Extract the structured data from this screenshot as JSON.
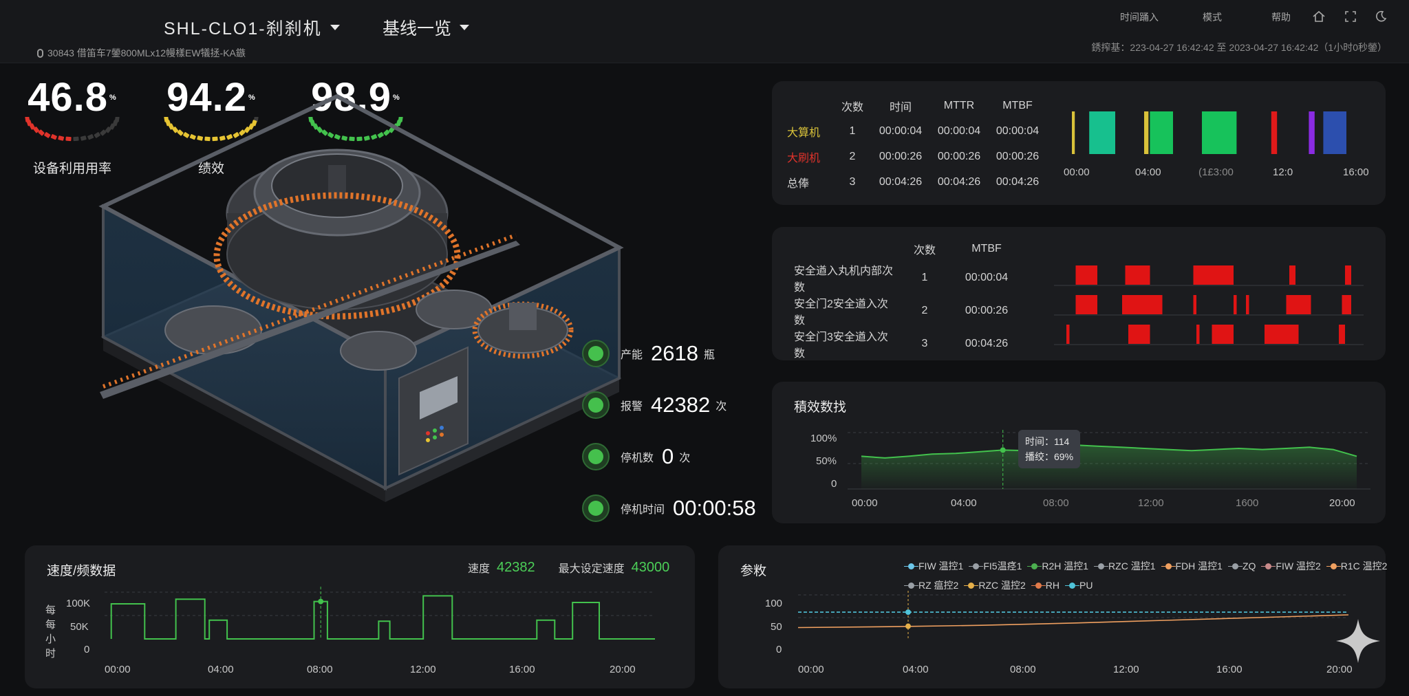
{
  "header": {
    "title": "SHL-CLO1-刹刹机",
    "baseline": "基线一览",
    "subinfo": "30843 借笛车7鎣800MLx12幔樣EW犠拯-KA鏃",
    "menu": [
      "时间踊入",
      "模式",
      "帮助"
    ],
    "time_range": "銹搾基：223-04-27 16:42:42 至 2023-04-27 16:42:42（1小时0秒鎣）"
  },
  "kpis": [
    {
      "value": "46.8",
      "unit": "%",
      "label": "设备利用用率",
      "color": "#e0332b",
      "fraction": 0.468
    },
    {
      "value": "94.2",
      "unit": "%",
      "label": "绩效",
      "color": "#e6c433",
      "fraction": 0.942
    },
    {
      "value": "98.9",
      "unit": "%",
      "label": "质量",
      "color": "#43c24d",
      "fraction": 0.989
    }
  ],
  "stats": [
    {
      "label": "产能",
      "value": "2618",
      "unit": "瓶"
    },
    {
      "label": "报警",
      "value": "42382",
      "unit": "次"
    },
    {
      "label": "停机数",
      "value": "0",
      "unit": "次"
    },
    {
      "label": "停机时间",
      "value": "00:00:58",
      "unit": ""
    }
  ],
  "downtime_card": {
    "headers": [
      "",
      "次数",
      "时间",
      "MTTR",
      "MTBF"
    ],
    "rows": [
      {
        "name": "大算机",
        "color": "#d9c23a",
        "count": "1",
        "time": "00:00:04",
        "mttr": "00:00:04",
        "mtbf": "00:00:04"
      },
      {
        "name": "大刷机",
        "color": "#e0332b",
        "count": "2",
        "time": "00:00:26",
        "mttr": "00:00:26",
        "mtbf": "00:00:26"
      },
      {
        "name": "总俸",
        "color": "#d4d4d4",
        "count": "3",
        "time": "00:04:26",
        "mttr": "00:04:26",
        "mtbf": "00:04:26"
      }
    ],
    "timeline_ticks": [
      "00:00",
      "04:00",
      "(1£3:00",
      "12:0",
      "16:00"
    ],
    "timeline_blocks": [
      {
        "start": 0.0,
        "end": 0.01,
        "color": "#d9c23a"
      },
      {
        "start": 0.06,
        "end": 0.15,
        "color": "#17c08e"
      },
      {
        "start": 0.25,
        "end": 0.265,
        "color": "#d9c23a"
      },
      {
        "start": 0.27,
        "end": 0.35,
        "color": "#17c25b"
      },
      {
        "start": 0.45,
        "end": 0.57,
        "color": "#17c25b"
      },
      {
        "start": 0.69,
        "end": 0.71,
        "color": "#e01a1a"
      },
      {
        "start": 0.82,
        "end": 0.84,
        "color": "#8a2be2"
      },
      {
        "start": 0.87,
        "end": 0.95,
        "color": "#2c4fae"
      }
    ]
  },
  "safety_card": {
    "headers": [
      "",
      "次数",
      "MTBF"
    ],
    "rows": [
      {
        "name": "安全遒入丸机内部次数",
        "count": "1",
        "mtbf": "00:00:04",
        "blocks": [
          [
            0.07,
            0.14
          ],
          [
            0.23,
            0.31
          ],
          [
            0.45,
            0.58
          ],
          [
            0.76,
            0.78
          ],
          [
            0.94,
            0.96
          ]
        ]
      },
      {
        "name": "安全门2安全遒入次数",
        "count": "2",
        "mtbf": "00:00:26",
        "blocks": [
          [
            0.07,
            0.14
          ],
          [
            0.22,
            0.35
          ],
          [
            0.45,
            0.46
          ],
          [
            0.58,
            0.59
          ],
          [
            0.62,
            0.63
          ],
          [
            0.75,
            0.83
          ],
          [
            0.93,
            0.96
          ]
        ]
      },
      {
        "name": "安全门3安全遒入次数",
        "count": "3",
        "mtbf": "00:04:26",
        "blocks": [
          [
            0.04,
            0.05
          ],
          [
            0.24,
            0.31
          ],
          [
            0.46,
            0.47
          ],
          [
            0.51,
            0.58
          ],
          [
            0.68,
            0.79
          ],
          [
            0.92,
            0.94
          ]
        ]
      }
    ]
  },
  "performance_card": {
    "title": "積效数找",
    "y_ticks": [
      "100%",
      "50%",
      "0"
    ],
    "x_ticks": [
      "00:00",
      "04:00",
      "08:00",
      "12:00",
      "1600",
      "20:00"
    ],
    "tooltip": {
      "time": "时间：114",
      "value": "播绞：69%"
    }
  },
  "speed_card": {
    "title": "速度/频数据",
    "speed_label": "速度",
    "speed_value": "42382",
    "max_label": "最大设定速度",
    "max_value": "43000",
    "y_ticks": [
      "100K",
      "50K",
      "0"
    ],
    "y_label": "每 每小时",
    "x_ticks": [
      "00:00",
      "04:00",
      "08:00",
      "12:00",
      "16:00",
      "20:00"
    ]
  },
  "params_card": {
    "title": "参敉",
    "legend": [
      {
        "name": "FIW 温控1",
        "color": "#6cc7ea"
      },
      {
        "name": "FI5温痉1",
        "color": "#9aa0a6"
      },
      {
        "name": "R2H 温控1",
        "color": "#4caf50"
      },
      {
        "name": "RZC 温控1",
        "color": "#9aa0a6"
      },
      {
        "name": "FDH 温控1",
        "color": "#f0a060"
      },
      {
        "name": "ZQ",
        "color": "#9aa0a6"
      },
      {
        "name": "FIW 温控2",
        "color": "#c98a8a"
      },
      {
        "name": "R1C 温控2",
        "color": "#f0a060"
      },
      {
        "name": "RZ 瘟控2",
        "color": "#9aa0a6"
      },
      {
        "name": "RZC 温控2",
        "color": "#e6b04a"
      },
      {
        "name": "RH",
        "color": "#e07a4a"
      },
      {
        "name": "PU",
        "color": "#4fc3d9"
      }
    ],
    "y_ticks": [
      "100",
      "50",
      "0"
    ],
    "x_ticks": [
      "00:00",
      "04:00",
      "08:00",
      "12:00",
      "16:00",
      "20:00"
    ]
  },
  "chart_data": [
    {
      "type": "area",
      "title": "積效数找",
      "x": [
        0,
        1,
        2,
        3,
        4,
        5,
        6,
        7,
        8,
        9,
        10,
        11,
        12,
        13,
        14,
        15,
        16,
        17,
        18,
        19,
        20,
        21
      ],
      "series": [
        {
          "values": [
            58,
            55,
            58,
            62,
            63,
            66,
            69,
            68,
            74,
            78,
            76,
            74,
            72,
            70,
            68,
            70,
            72,
            70,
            72,
            74,
            70,
            58
          ]
        }
      ],
      "ylim": [
        0,
        100
      ]
    },
    {
      "type": "line",
      "title": "速度/频数据",
      "x": [
        "00:00",
        "04:00",
        "08:00",
        "12:00",
        "16:00",
        "20:00"
      ],
      "series": [
        {
          "values": [
            [
              0.3,
              0
            ],
            [
              0.3,
              75
            ],
            [
              1.8,
              75
            ],
            [
              1.8,
              0
            ],
            [
              3.2,
              0
            ],
            [
              3.2,
              85
            ],
            [
              4.5,
              85
            ],
            [
              4.5,
              0
            ],
            [
              4.7,
              0
            ],
            [
              4.7,
              40
            ],
            [
              5.5,
              40
            ],
            [
              5.5,
              0
            ],
            [
              9.4,
              0
            ],
            [
              9.4,
              80
            ],
            [
              10.0,
              80
            ],
            [
              10.0,
              0
            ],
            [
              12.3,
              0
            ],
            [
              12.3,
              38
            ],
            [
              12.8,
              38
            ],
            [
              12.8,
              0
            ],
            [
              14.3,
              0
            ],
            [
              14.3,
              92
            ],
            [
              15.6,
              92
            ],
            [
              15.6,
              0
            ],
            [
              19.4,
              0
            ],
            [
              19.4,
              40
            ],
            [
              20.2,
              40
            ],
            [
              20.2,
              0
            ],
            [
              21.0,
              0
            ],
            [
              21.0,
              78
            ],
            [
              22.2,
              78
            ],
            [
              22.2,
              0
            ],
            [
              24.7,
              0
            ]
          ]
        }
      ],
      "ylim": [
        0,
        100
      ]
    },
    {
      "type": "line",
      "title": "参敉",
      "x": [
        "00:00",
        "04:00",
        "08:00",
        "12:00",
        "16:00",
        "20:00"
      ],
      "series": [
        {
          "name": "FIW 温控1",
          "values": [
            62,
            62,
            62,
            62,
            62,
            62,
            62
          ]
        },
        {
          "name": "FDH 温控1",
          "values": [
            28,
            30,
            33,
            38,
            44,
            50,
            56
          ]
        }
      ],
      "ylim": [
        0,
        100
      ]
    }
  ]
}
